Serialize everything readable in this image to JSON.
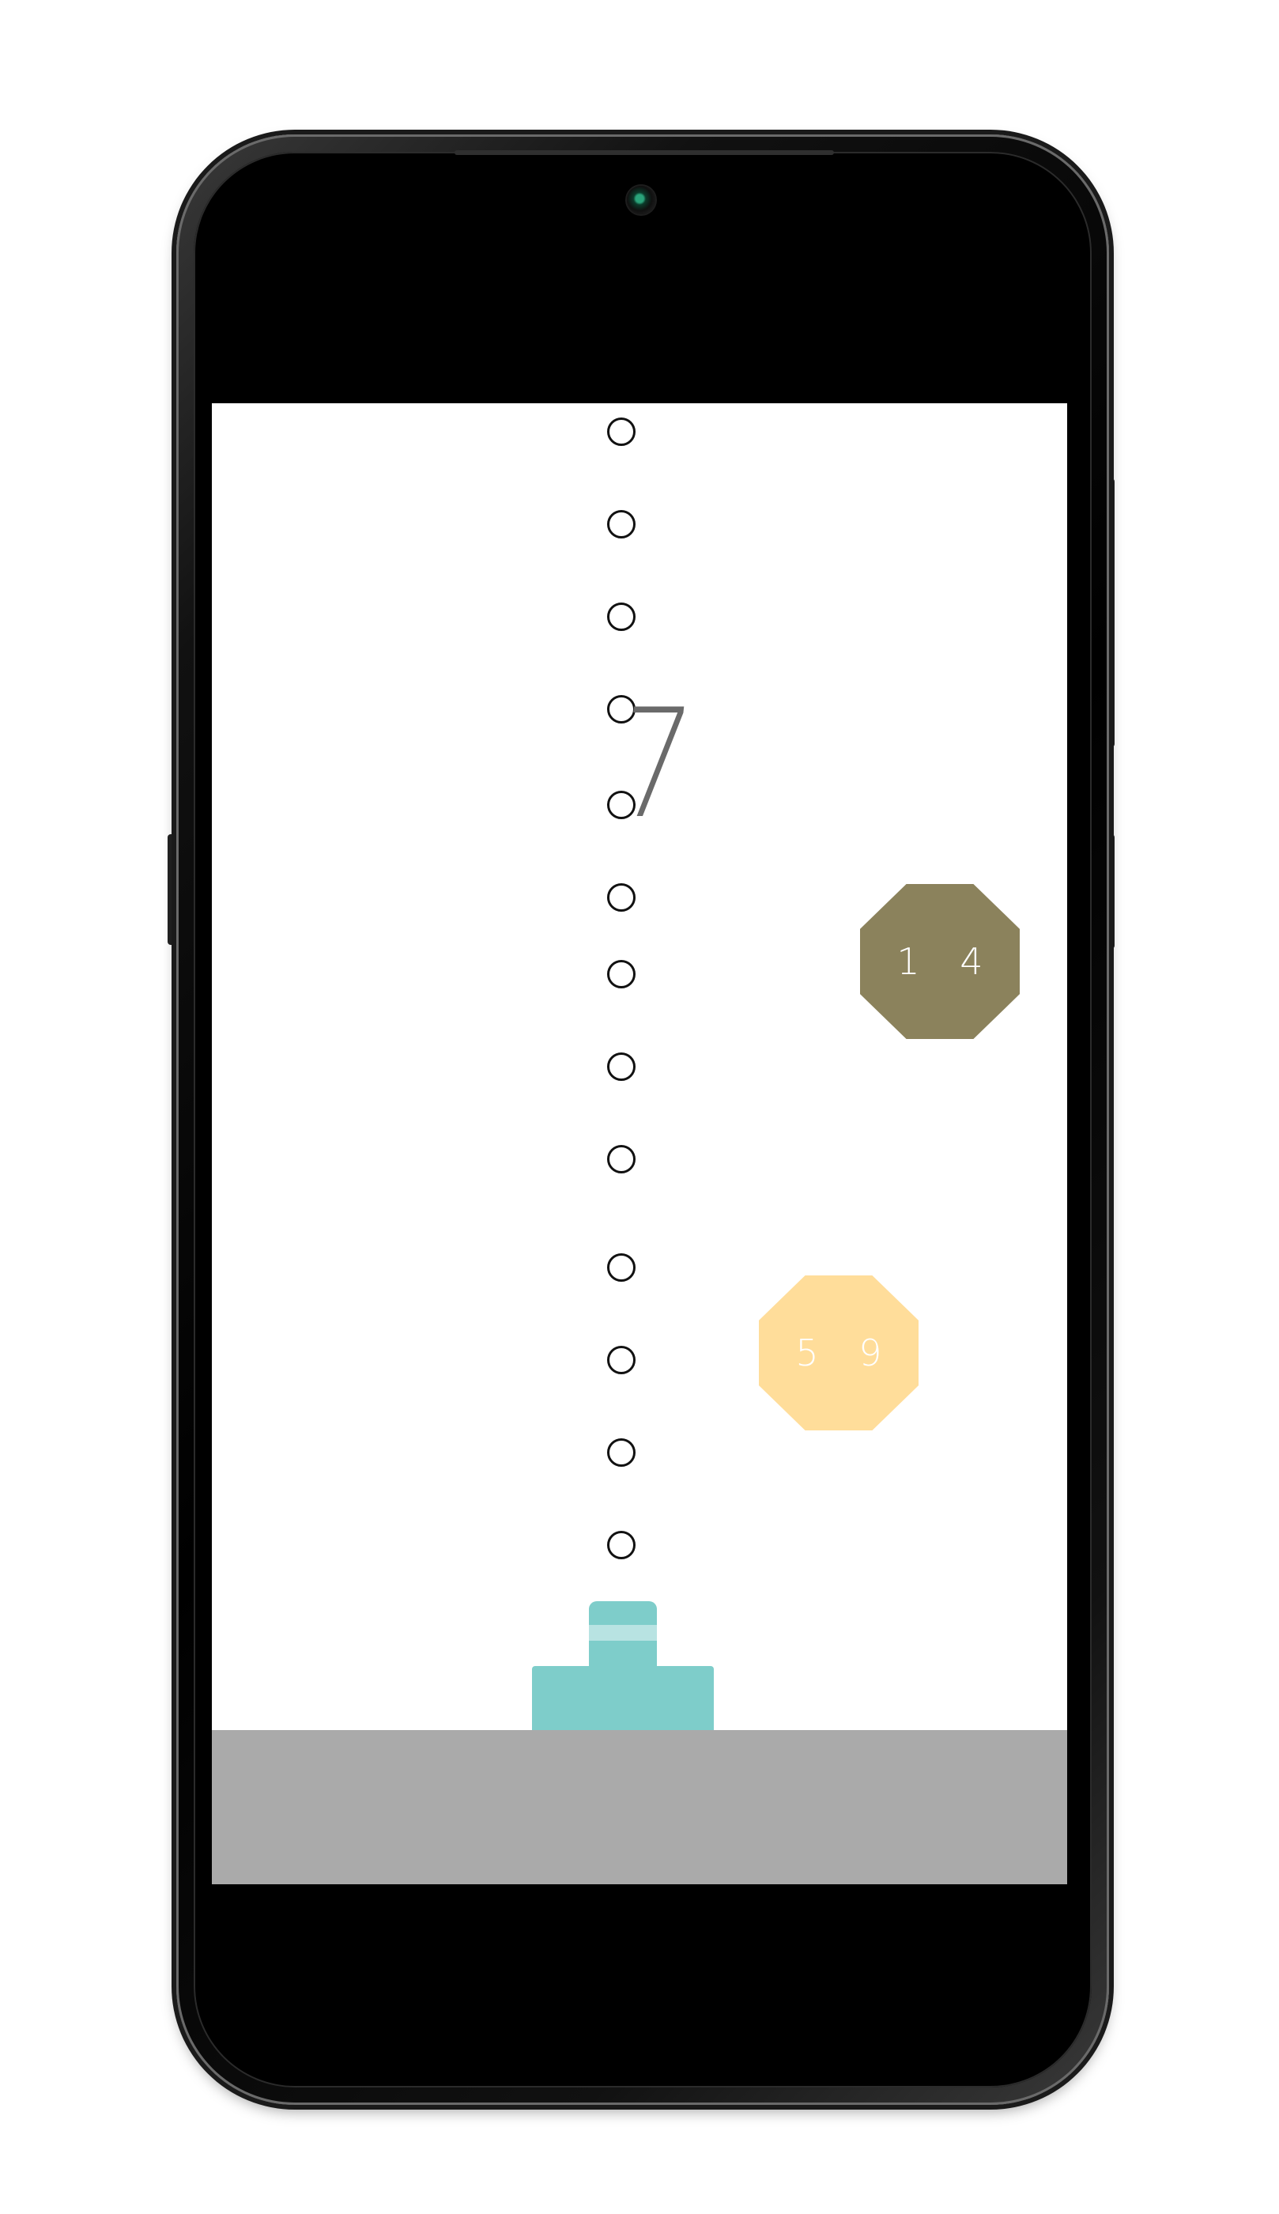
{
  "game": {
    "score": "7",
    "blocks": [
      {
        "label": "1 4",
        "color": "#8b825c"
      },
      {
        "label": "5 9",
        "color": "#ffdd9a"
      }
    ],
    "aim_dots": 13,
    "cannon_color": "#7ecdca",
    "ground_color": "#aaaaaa"
  },
  "device": {
    "frame_color": "#000000"
  }
}
